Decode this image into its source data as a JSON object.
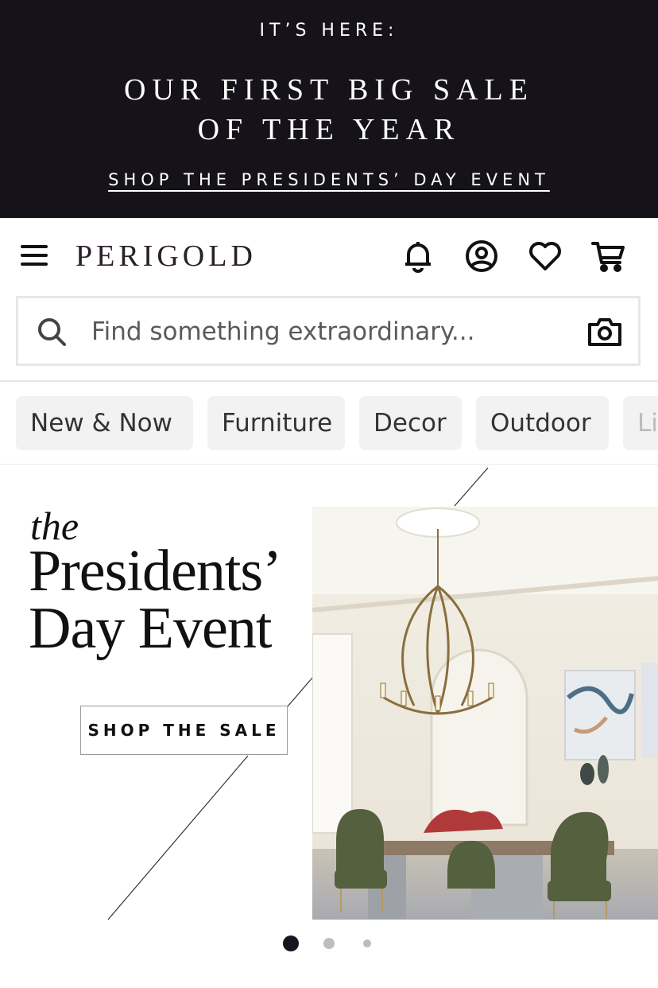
{
  "promo": {
    "kicker": "IT’S HERE:",
    "headline_line1": "OUR FIRST BIG SALE",
    "headline_line2": "OF THE YEAR",
    "link_label": "SHOP THE PRESIDENTS’ DAY EVENT",
    "background_color": "#15121a"
  },
  "header": {
    "logo": "PERIGOLD",
    "icons": [
      "menu-icon",
      "bell-icon",
      "account-icon",
      "heart-icon",
      "cart-icon"
    ]
  },
  "search": {
    "placeholder": "Find something extraordinary...",
    "value": "",
    "icons": [
      "search-icon",
      "camera-icon"
    ]
  },
  "categories": [
    {
      "label": "New & Now"
    },
    {
      "label": "Furniture"
    },
    {
      "label": "Decor"
    },
    {
      "label": "Outdoor"
    },
    {
      "label": "Li"
    }
  ],
  "hero": {
    "eyebrow": "the",
    "title_line1": "Presidents’",
    "title_line2": "Day Event",
    "cta_label": "SHOP THE SALE"
  },
  "carousel": {
    "slide_count": 3,
    "active_index": 0,
    "active_color": "#1a1420",
    "inactive_color": "#bdbdbd"
  }
}
